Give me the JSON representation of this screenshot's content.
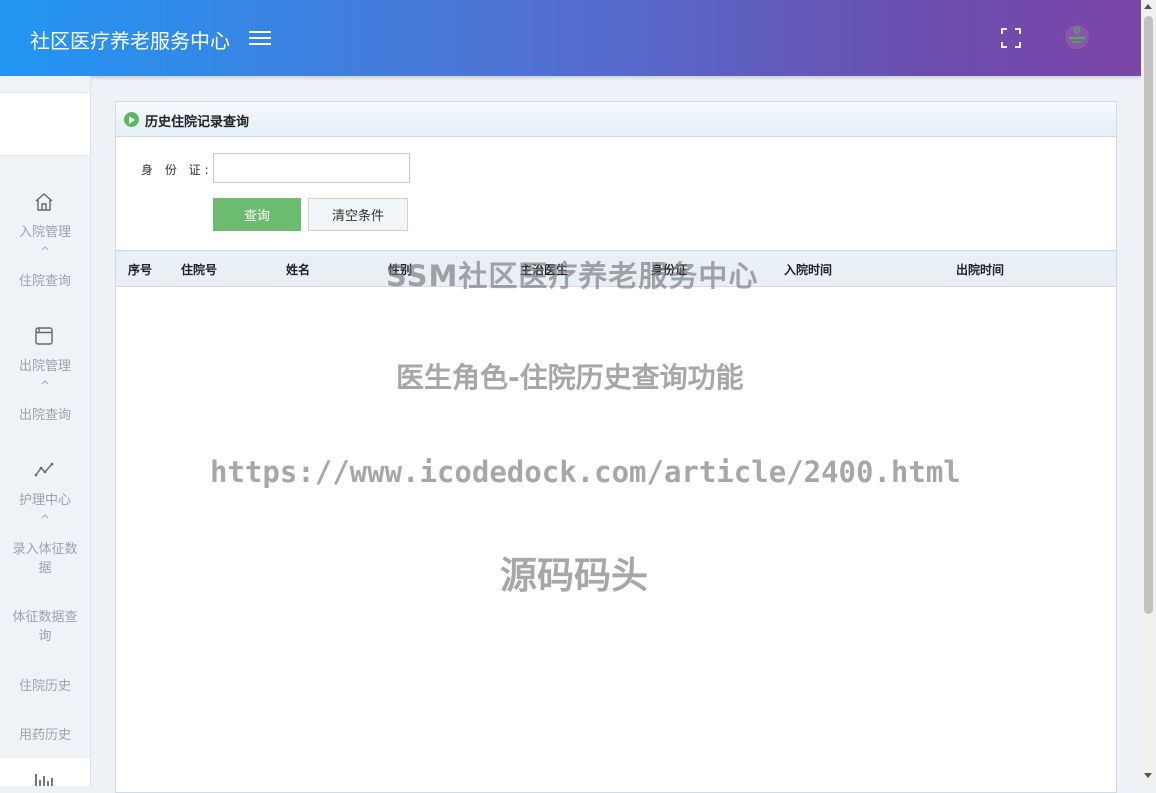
{
  "header": {
    "app_title": "社区医疗养老服务中心",
    "icons": [
      "menu-icon",
      "fullscreen-icon",
      "avatar"
    ]
  },
  "sidebar": {
    "groups": [
      {
        "label": "入院管理",
        "icon": "home-icon",
        "children": [
          "住院查询"
        ]
      },
      {
        "label": "出院管理",
        "icon": "window-icon",
        "children": [
          "出院查询"
        ]
      },
      {
        "label": "护理中心",
        "icon": "trend-icon",
        "children": [
          "录入体征数据",
          "体征数据查询",
          "住院历史",
          "用药历史"
        ]
      }
    ],
    "next_group_icon": "bar-chart-icon"
  },
  "panel": {
    "title": "历史住院记录查询",
    "form": {
      "id_label": "身 份 证:",
      "id_value": "",
      "id_placeholder": ""
    },
    "buttons": {
      "query": "查询",
      "clear": "清空条件"
    },
    "table": {
      "columns": [
        "序号",
        "住院号",
        "姓名",
        "性别",
        "主治医生",
        "身份证",
        "入院时间",
        "出院时间"
      ],
      "rows": []
    }
  },
  "watermarks": {
    "line1": "SSM社区医疗养老服务中心",
    "line2": "医生角色-住院历史查询功能",
    "line3": "https://www.icodedock.com/article/2400.html",
    "line4": "源码码头"
  },
  "colors": {
    "header_start": "#2196f3",
    "header_end": "#7b45a8",
    "query_button": "#6dbb71",
    "panel_border": "#cfdbe6"
  }
}
